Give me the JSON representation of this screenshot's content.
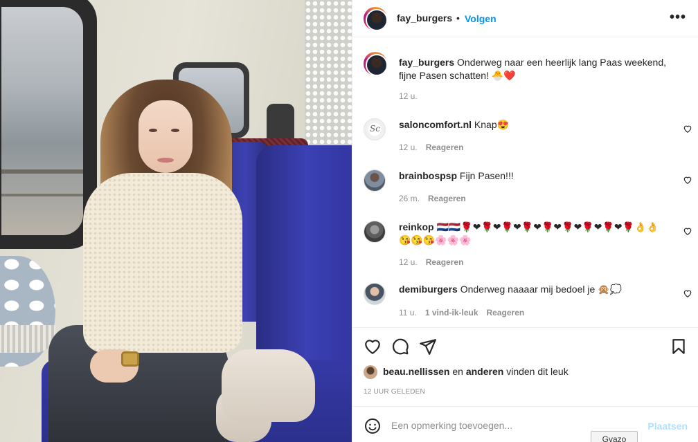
{
  "post": {
    "username": "fay_burgers",
    "follow_label": "Volgen",
    "caption_user": "fay_burgers",
    "caption_text": "Onderweg naar een heerlijk lang Paas weekend, fijne Pasen schatten! 🐣❤️",
    "caption_time": "12 u."
  },
  "comments": [
    {
      "user": "saloncomfort.nl",
      "text": "Knap😍",
      "time": "12 u.",
      "likes": "",
      "reply": "Reageren"
    },
    {
      "user": "brainbospsp",
      "text": "Fijn Pasen!!!",
      "time": "26 m.",
      "likes": "",
      "reply": "Reageren"
    },
    {
      "user": "reinkop",
      "text": "🇳🇱🇳🇱🌹❤🌹❤🌹❤🌹❤🌹❤🌹❤🌹❤🌹❤🌹👌👌😘😘😘🌸🌸🌸",
      "time": "12 u.",
      "likes": "",
      "reply": "Reageren"
    },
    {
      "user": "demiburgers",
      "text": "Onderweg naaaar mij bedoel je 🙊💭",
      "time": "11 u.",
      "likes": "1 vind-ik-leuk",
      "reply": "Reageren"
    }
  ],
  "likes": {
    "user": "beau.nellissen",
    "joiner": "en",
    "others": "anderen",
    "suffix": "vinden dit leuk"
  },
  "timestamp": "12 UUR GELEDEN",
  "composer": {
    "placeholder": "Een opmerking toevoegen...",
    "post_label": "Plaatsen"
  },
  "tooltip": "Gvazo",
  "icons": {
    "header": "more-options-icon",
    "actions": [
      "heart-icon",
      "comment-icon",
      "share-icon",
      "bookmark-icon"
    ],
    "composer": "emoji-icon"
  },
  "colors": {
    "link": "#0095f6",
    "muted": "#8e8e8e",
    "post_disabled": "#b2dffc",
    "text": "#262626"
  }
}
